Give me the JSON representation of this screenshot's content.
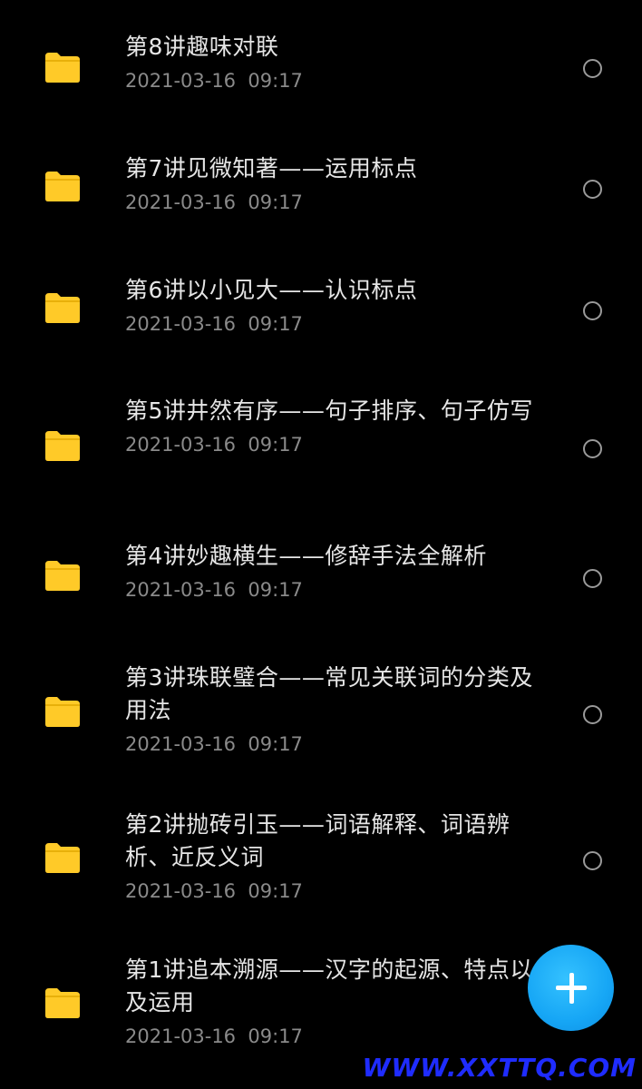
{
  "items": [
    {
      "title": "第8讲趣味对联",
      "date": "2021-03-16  09:17"
    },
    {
      "title": "第7讲见微知著——运用标点",
      "date": "2021-03-16  09:17"
    },
    {
      "title": "第6讲以小见大——认识标点",
      "date": "2021-03-16  09:17"
    },
    {
      "title": "第5讲井然有序——句子排序、句子仿写",
      "date": "2021-03-16  09:17"
    },
    {
      "title": "第4讲妙趣横生——修辞手法全解析",
      "date": "2021-03-16  09:17"
    },
    {
      "title": "第3讲珠联璧合——常见关联词的分类及用法",
      "date": "2021-03-16  09:17"
    },
    {
      "title": "第2讲抛砖引玉——词语解释、词语辨析、近反义词",
      "date": "2021-03-16  09:17"
    },
    {
      "title": "第1讲追本溯源——汉字的起源、特点以及运用",
      "date": "2021-03-16  09:17"
    }
  ],
  "icons": {
    "folder": "folder-icon",
    "select": "radio-circle-icon",
    "fab": "plus-icon"
  },
  "colors": {
    "background": "#000000",
    "folder": "#FFCA28",
    "fab": "#16A6F5",
    "watermark": "#1F2CFF"
  },
  "watermark": "WWW.XXTTQ.COM"
}
